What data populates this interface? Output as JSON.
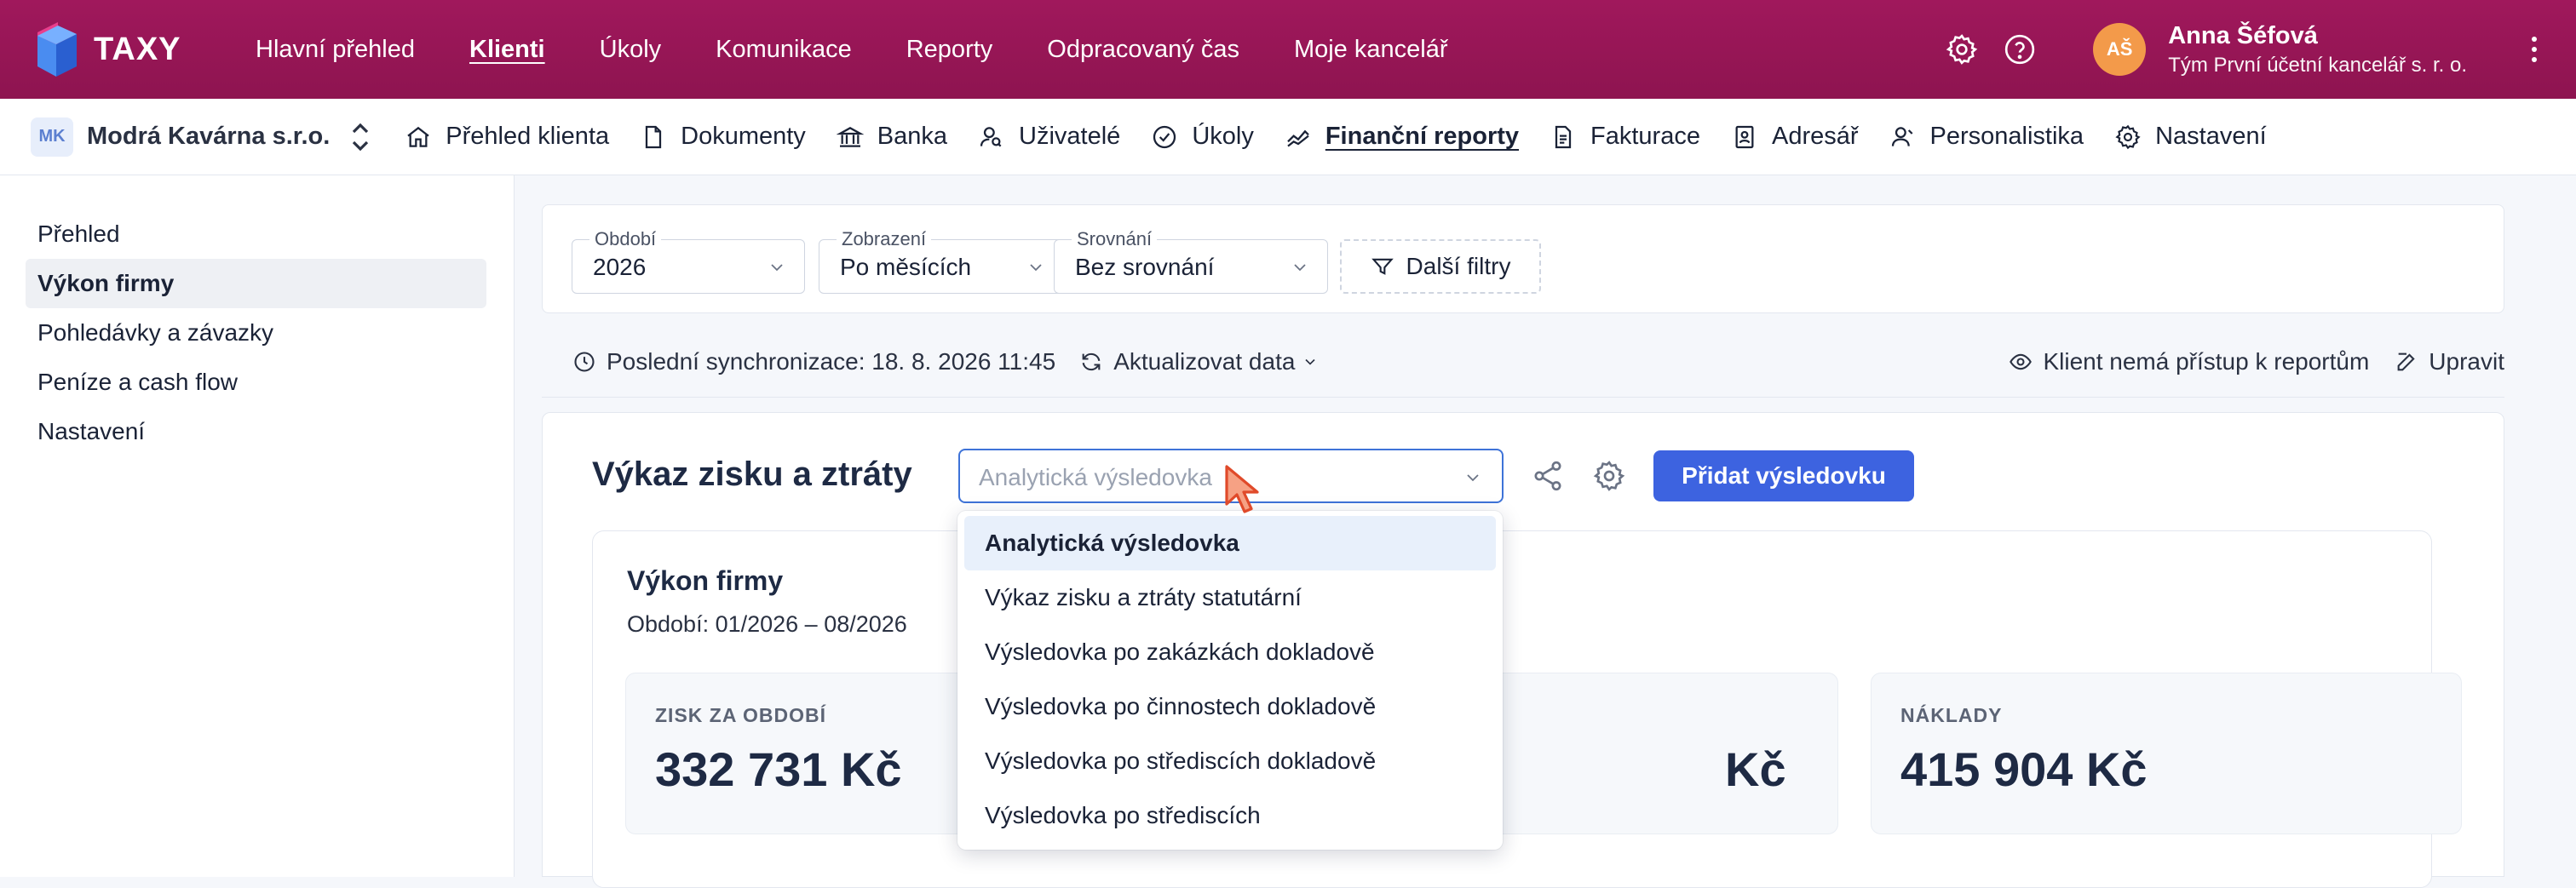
{
  "app": {
    "brand": "TAXY"
  },
  "topnav": {
    "items": [
      {
        "label": "Hlavní přehled",
        "active": false
      },
      {
        "label": "Klienti",
        "active": true
      },
      {
        "label": "Úkoly",
        "active": false
      },
      {
        "label": "Komunikace",
        "active": false
      },
      {
        "label": "Reporty",
        "active": false
      },
      {
        "label": "Odpracovaný čas",
        "active": false
      },
      {
        "label": "Moje kancelář",
        "active": false
      }
    ]
  },
  "user": {
    "initials": "AŠ",
    "name": "Anna Šéfová",
    "team": "Tým První účetní kancelář s. r. o."
  },
  "client": {
    "badge": "MK",
    "name": "Modrá Kavárna s.r.o.",
    "tabs": [
      {
        "label": "Přehled klienta",
        "icon": "home-icon"
      },
      {
        "label": "Dokumenty",
        "icon": "document-icon"
      },
      {
        "label": "Banka",
        "icon": "bank-icon"
      },
      {
        "label": "Uživatelé",
        "icon": "users-icon"
      },
      {
        "label": "Úkoly",
        "icon": "check-circle-icon"
      },
      {
        "label": "Finanční reporty",
        "icon": "chart-line-icon",
        "active": true
      },
      {
        "label": "Fakturace",
        "icon": "invoice-icon"
      },
      {
        "label": "Adresář",
        "icon": "contact-book-icon"
      },
      {
        "label": "Personalistika",
        "icon": "person-icon"
      },
      {
        "label": "Nastavení",
        "icon": "gear-icon"
      }
    ]
  },
  "sidebar": {
    "items": [
      {
        "label": "Přehled",
        "active": false
      },
      {
        "label": "Výkon firmy",
        "active": true
      },
      {
        "label": "Pohledávky a závazky",
        "active": false
      },
      {
        "label": "Peníze a cash flow",
        "active": false
      },
      {
        "label": "Nastavení",
        "active": false
      }
    ]
  },
  "filters": {
    "period": {
      "label": "Období",
      "value": "2026"
    },
    "view": {
      "label": "Zobrazení",
      "value": "Po měsících"
    },
    "compare": {
      "label": "Srovnání",
      "value": "Bez srovnání"
    },
    "more": "Další filtry"
  },
  "sync": {
    "last": "Poslední synchronizace: 18. 8. 2026 11:45",
    "refresh": "Aktualizovat data",
    "access": "Klient nemá přístup k reportům",
    "edit": "Upravit"
  },
  "report": {
    "title": "Výkaz zisku a ztráty",
    "select_placeholder": "Analytická výsledovka",
    "add_button": "Přidat výsledovku",
    "card_title": "Výkon firmy",
    "card_period": "Období: 01/2026 – 08/2026",
    "kpis": [
      {
        "label": "ZISK ZA OBDOBÍ",
        "value": "332 731 Kč"
      },
      {
        "label": "",
        "value": "Kč"
      },
      {
        "label": "NÁKLADY",
        "value": "415 904 Kč"
      }
    ]
  },
  "dropdown": {
    "options": [
      {
        "label": "Analytická výsledovka",
        "selected": true
      },
      {
        "label": "Výkaz zisku a ztráty statutární",
        "selected": false
      },
      {
        "label": "Výsledovka po zakázkách dokladově",
        "selected": false
      },
      {
        "label": "Výsledovka po činnostech dokladově",
        "selected": false
      },
      {
        "label": "Výsledovka po střediscích dokladově",
        "selected": false
      },
      {
        "label": "Výsledovka po střediscích",
        "selected": false
      }
    ]
  },
  "colors": {
    "topbar": "#a0185c",
    "accent": "#3d63e0",
    "avatar": "#f39a4a",
    "select_border": "#3e73d8"
  }
}
